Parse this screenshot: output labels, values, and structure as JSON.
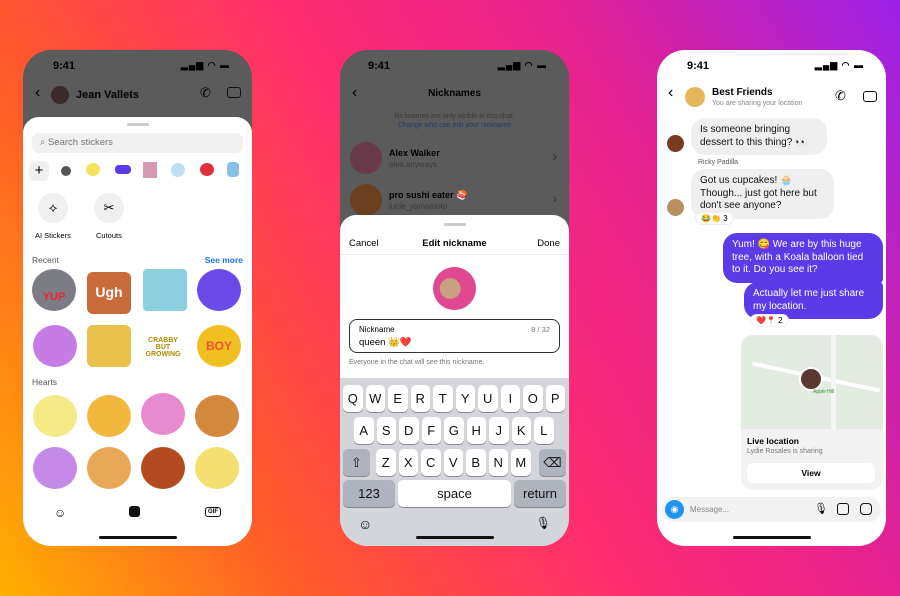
{
  "status": {
    "time": "9:41",
    "signal": "signal-icon",
    "wifi": "wifi-icon",
    "battery": "battery-icon"
  },
  "phone1": {
    "contact": "Jean Vallets",
    "search_placeholder": "Search stickers",
    "tools": [
      {
        "label": "AI Stickers",
        "icon": "ai-sparkle-icon"
      },
      {
        "label": "Cutouts",
        "icon": "scissors-icon"
      }
    ],
    "recent_label": "Recent",
    "see_more": "See more",
    "hearts_label": "Hearts",
    "sticker_texts": [
      "YUP",
      "Ugh",
      "CRABBY BUT GROWING",
      "BOY"
    ],
    "tabs": [
      "avatar-icon",
      "sticker-icon",
      "gif-icon"
    ],
    "gif_label": "GIF"
  },
  "phone2": {
    "title": "Nicknames",
    "notice": "Nicknames are only visible in this chat.",
    "notice_link": "Change who can edit your nickname",
    "people": [
      {
        "name": "Alex Walker",
        "handle": "alex.anyways"
      },
      {
        "name": "pro sushi eater 🍣",
        "handle": "lucie_yamamoto"
      }
    ],
    "sheet": {
      "cancel": "Cancel",
      "title": "Edit nickname",
      "done": "Done",
      "field_label": "Nickname",
      "field_value": "queen 👑❤️",
      "counter": "8 / 32",
      "helper": "Everyone in the chat will see this nickname."
    },
    "keyboard": {
      "row1": [
        "Q",
        "W",
        "E",
        "R",
        "T",
        "Y",
        "U",
        "I",
        "O",
        "P"
      ],
      "row2": [
        "A",
        "S",
        "D",
        "F",
        "G",
        "H",
        "J",
        "K",
        "L"
      ],
      "row3": [
        "Z",
        "X",
        "C",
        "V",
        "B",
        "N",
        "M"
      ],
      "numbers": "123",
      "space": "space",
      "return": "return"
    }
  },
  "phone3": {
    "title": "Best Friends",
    "subtitle": "You are sharing your location",
    "messages": [
      {
        "text": "Is someone bringing dessert to this thing? 👀",
        "dir": "in"
      },
      {
        "sender": "Ricky Padilla",
        "text": "Got us cupcakes! 🧁 Though... just got here but don't see anyone?",
        "dir": "in",
        "reactions": "😂👏 3"
      },
      {
        "text": "Yum! 😋 We are by this huge tree, with a Koala balloon tied to it. Do you see it?",
        "dir": "out"
      },
      {
        "text": "Actually let me just share my location.",
        "dir": "out",
        "reactions": "❤️📍 2"
      }
    ],
    "location": {
      "title": "Live location",
      "subtitle": "Lydie Rosales is sharing",
      "button": "View",
      "map_label": "Apple Hill"
    },
    "composer_placeholder": "Message..."
  },
  "colors": {
    "accent": "#5b3be8",
    "link": "#1877f2",
    "camera": "#1e96f0"
  }
}
